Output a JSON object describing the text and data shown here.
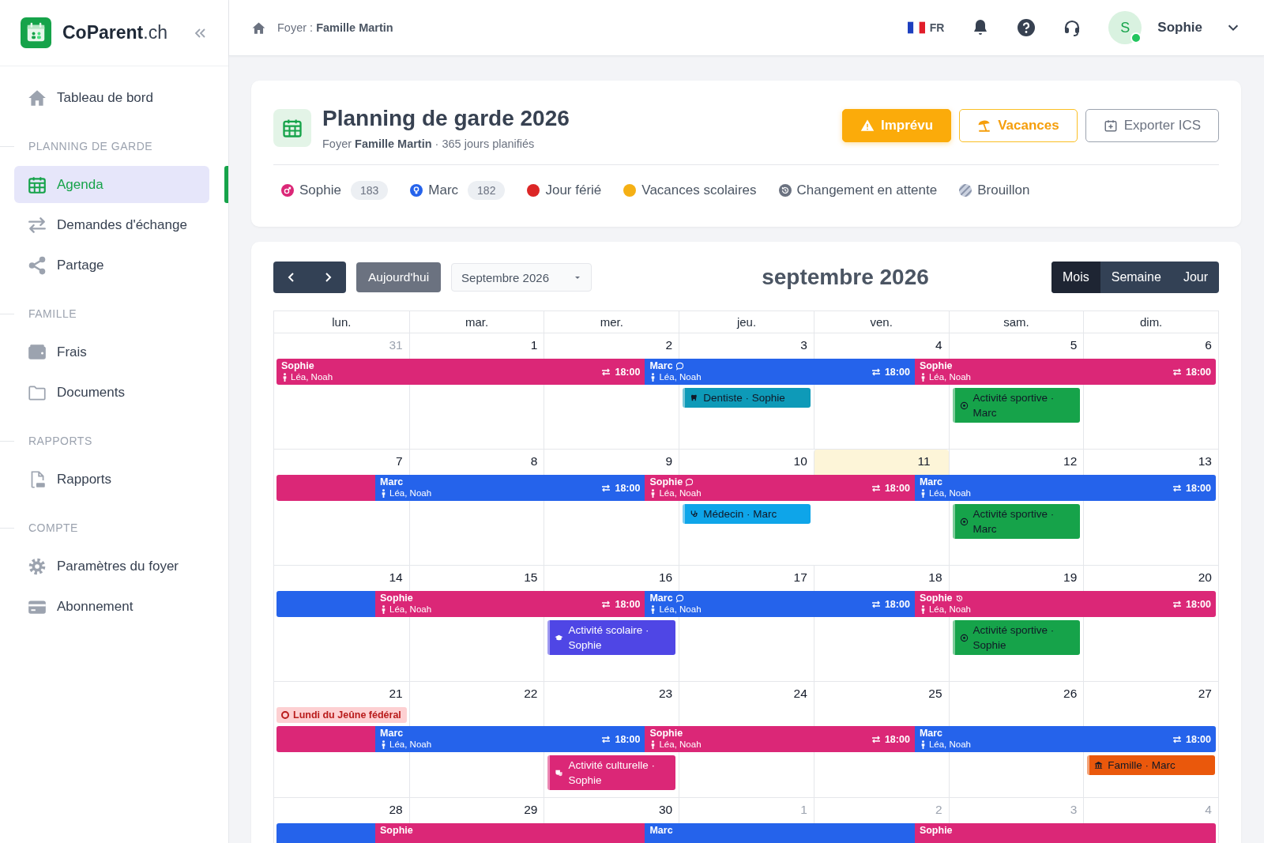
{
  "brand": {
    "logo": "**CoParent**.ch"
  },
  "sidebar": {
    "sections": [
      {
        "items": [
          {
            "label": "Tableau de bord",
            "selected": false
          }
        ]
      },
      {
        "title": "PLANNING DE GARDE",
        "items": [
          {
            "label": "Agenda",
            "selected": true
          },
          {
            "label": "Demandes d'échange",
            "selected": false
          },
          {
            "label": "Partage",
            "selected": false
          }
        ]
      },
      {
        "title": "FAMILLE",
        "items": [
          {
            "label": "Frais",
            "selected": false
          },
          {
            "label": "Documents",
            "selected": false
          }
        ]
      },
      {
        "title": "RAPPORTS",
        "items": [
          {
            "label": "Rapports",
            "selected": false
          }
        ]
      },
      {
        "title": "COMPTE",
        "items": [
          {
            "label": "Paramètres du foyer",
            "selected": false
          },
          {
            "label": "Abonnement",
            "selected": false
          }
        ]
      }
    ]
  },
  "topbar": {
    "breadcrumb": "Foyer : **Famille Martin**",
    "language": "FR",
    "user": {
      "initial": "S",
      "name": "Sophie",
      "online": true
    }
  },
  "planning": {
    "title": "Planning de garde 2026",
    "subtitle": "Foyer **Famille Martin** · 365 jours planifiés",
    "buttons": [
      {
        "kind": "warning",
        "label": "Imprévu"
      },
      {
        "kind": "vacation",
        "label": "Vacances"
      },
      {
        "kind": "export",
        "label": "Exporter ICS"
      }
    ],
    "legend": [
      {
        "kind": "parent",
        "label": "Sophie",
        "count": "183",
        "color": "#db2777"
      },
      {
        "kind": "parent",
        "label": "Marc",
        "count": "182",
        "color": "#2563eb"
      },
      {
        "kind": "dot",
        "label": "Jour férié",
        "color": "#dc2626"
      },
      {
        "kind": "dot",
        "label": "Vacances scolaires",
        "color": "#f5b014"
      },
      {
        "kind": "pending",
        "label": "Changement en attente"
      },
      {
        "kind": "draft",
        "label": "Brouillon"
      }
    ]
  },
  "calendar": {
    "today_button": "Aujourd'hui",
    "month_select": "Septembre 2026",
    "title": "septembre 2026",
    "views": [
      {
        "label": "Mois",
        "selected": true
      },
      {
        "label": "Semaine",
        "selected": false
      },
      {
        "label": "Jour",
        "selected": false
      }
    ],
    "weekdays": [
      "lun.",
      "mar.",
      "mer.",
      "jeu.",
      "ven.",
      "sam.",
      "dim."
    ],
    "weeks": [
      {
        "days": [
          {
            "number": "31",
            "muted": true,
            "today": false,
            "handover": false
          },
          {
            "number": "1",
            "muted": false,
            "today": false,
            "handover": false
          },
          {
            "number": "2",
            "muted": false,
            "today": false,
            "handover": true
          },
          {
            "number": "3",
            "muted": false,
            "today": false,
            "handover": false,
            "events": [
              {
                "kind": "tooth",
                "text": "**Dentiste** · Sophie",
                "color": "#0e9ab8"
              }
            ]
          },
          {
            "number": "4",
            "muted": false,
            "today": false,
            "handover": true
          },
          {
            "number": "5",
            "muted": false,
            "today": false,
            "handover": false,
            "events": [
              {
                "kind": "ball",
                "text": "**Activité sportive** · Marc",
                "color": "#16a34a"
              }
            ]
          },
          {
            "number": "6",
            "muted": false,
            "today": false,
            "handover": false
          }
        ],
        "segments": [
          {
            "name": "Sophie",
            "comment": false,
            "pending": false,
            "children": "Léa, Noah",
            "time": "18:00",
            "color": "#db2777"
          },
          {
            "name": "Marc",
            "comment": true,
            "pending": false,
            "children": "Léa, Noah",
            "time": "18:00",
            "color": "#2563eb"
          },
          {
            "name": "Sophie",
            "comment": false,
            "pending": false,
            "children": "Léa, Noah",
            "time": "18:00",
            "color": "#db2777"
          }
        ]
      },
      {
        "days": [
          {
            "number": "7",
            "muted": false,
            "today": false,
            "handover": true
          },
          {
            "number": "8",
            "muted": false,
            "today": false,
            "handover": false
          },
          {
            "number": "9",
            "muted": false,
            "today": false,
            "handover": true
          },
          {
            "number": "10",
            "muted": false,
            "today": false,
            "handover": false,
            "events": [
              {
                "kind": "stethoscope",
                "text": "**Médecin** · Marc",
                "color": "#0ea5e9"
              }
            ]
          },
          {
            "number": "11",
            "muted": false,
            "today": true,
            "handover": true
          },
          {
            "number": "12",
            "muted": false,
            "today": false,
            "handover": false,
            "events": [
              {
                "kind": "ball",
                "text": "**Activité sportive** · Marc",
                "color": "#16a34a"
              }
            ]
          },
          {
            "number": "13",
            "muted": false,
            "today": false,
            "handover": false
          }
        ],
        "segments": [
          {
            "color": "#db2777"
          },
          {
            "name": "Marc",
            "comment": false,
            "pending": false,
            "children": "Léa, Noah",
            "time": "18:00",
            "color": "#2563eb"
          },
          {
            "name": "Sophie",
            "comment": true,
            "pending": false,
            "children": "Léa, Noah",
            "time": "18:00",
            "color": "#db2777"
          },
          {
            "name": "Marc",
            "comment": false,
            "pending": false,
            "children": "Léa, Noah",
            "time": "18:00",
            "color": "#2563eb"
          }
        ]
      },
      {
        "days": [
          {
            "number": "14",
            "muted": false,
            "today": false,
            "handover": true
          },
          {
            "number": "15",
            "muted": false,
            "today": false,
            "handover": false
          },
          {
            "number": "16",
            "muted": false,
            "today": false,
            "handover": true,
            "events": [
              {
                "kind": "school",
                "text": "**Activité scolaire** · Sophie",
                "color": "#4f46e5"
              }
            ]
          },
          {
            "number": "17",
            "muted": false,
            "today": false,
            "handover": false
          },
          {
            "number": "18",
            "muted": false,
            "today": false,
            "handover": true
          },
          {
            "number": "19",
            "muted": false,
            "today": false,
            "handover": false,
            "events": [
              {
                "kind": "ball",
                "text": "**Activité sportive** · Sophie",
                "color": "#16a34a"
              }
            ]
          },
          {
            "number": "20",
            "muted": false,
            "today": false,
            "handover": false
          }
        ],
        "segments": [
          {
            "color": "#2563eb"
          },
          {
            "name": "Sophie",
            "comment": false,
            "pending": false,
            "children": "Léa, Noah",
            "time": "18:00",
            "color": "#db2777"
          },
          {
            "name": "Marc",
            "comment": true,
            "pending": false,
            "children": "Léa, Noah",
            "time": "18:00",
            "color": "#2563eb"
          },
          {
            "name": "Sophie",
            "comment": false,
            "pending": true,
            "children": "Léa, Noah",
            "time": "18:00",
            "color": "#db2777"
          }
        ]
      },
      {
        "days": [
          {
            "number": "21",
            "muted": false,
            "today": false,
            "handover": true,
            "holiday": "Lundi du Jeûne fédéral"
          },
          {
            "number": "22",
            "muted": false,
            "today": false,
            "handover": false
          },
          {
            "number": "23",
            "muted": false,
            "today": false,
            "handover": true,
            "events": [
              {
                "kind": "mask",
                "text": "**Activité culturelle** · Sophie",
                "color": "#db2777"
              }
            ]
          },
          {
            "number": "24",
            "muted": false,
            "today": false,
            "handover": false
          },
          {
            "number": "25",
            "muted": false,
            "today": false,
            "handover": true
          },
          {
            "number": "26",
            "muted": false,
            "today": false,
            "handover": false
          },
          {
            "number": "27",
            "muted": false,
            "today": false,
            "handover": false,
            "events": [
              {
                "kind": "house",
                "text": "**Famille** · Marc",
                "color": "#ea580c"
              }
            ]
          }
        ],
        "segments": [
          {
            "color": "#db2777"
          },
          {
            "name": "Marc",
            "children": "Léa, Noah",
            "time": "18:00",
            "color": "#2563eb"
          },
          {
            "name": "Sophie",
            "children": "Léa, Noah",
            "time": "18:00",
            "color": "#db2777"
          },
          {
            "name": "Marc",
            "children": "Léa, Noah",
            "time": "18:00",
            "color": "#2563eb"
          }
        ]
      },
      {
        "days": [
          {
            "number": "28",
            "muted": false,
            "today": false,
            "handover": true
          },
          {
            "number": "29",
            "muted": false,
            "today": false,
            "handover": false
          },
          {
            "number": "30",
            "muted": false,
            "today": false,
            "handover": true
          },
          {
            "number": "1",
            "muted": true,
            "today": false,
            "handover": false
          },
          {
            "number": "2",
            "muted": true,
            "today": false,
            "handover": true
          },
          {
            "number": "3",
            "muted": true,
            "today": false,
            "handover": false
          },
          {
            "number": "4",
            "muted": true,
            "today": false,
            "handover": false
          }
        ],
        "segments": [
          {
            "color": "#2563eb"
          },
          {
            "name": "Sophie",
            "color": "#db2777"
          },
          {
            "name": "Marc",
            "color": "#2563eb"
          },
          {
            "name": "Sophie",
            "color": "#db2777"
          }
        ]
      }
    ]
  }
}
